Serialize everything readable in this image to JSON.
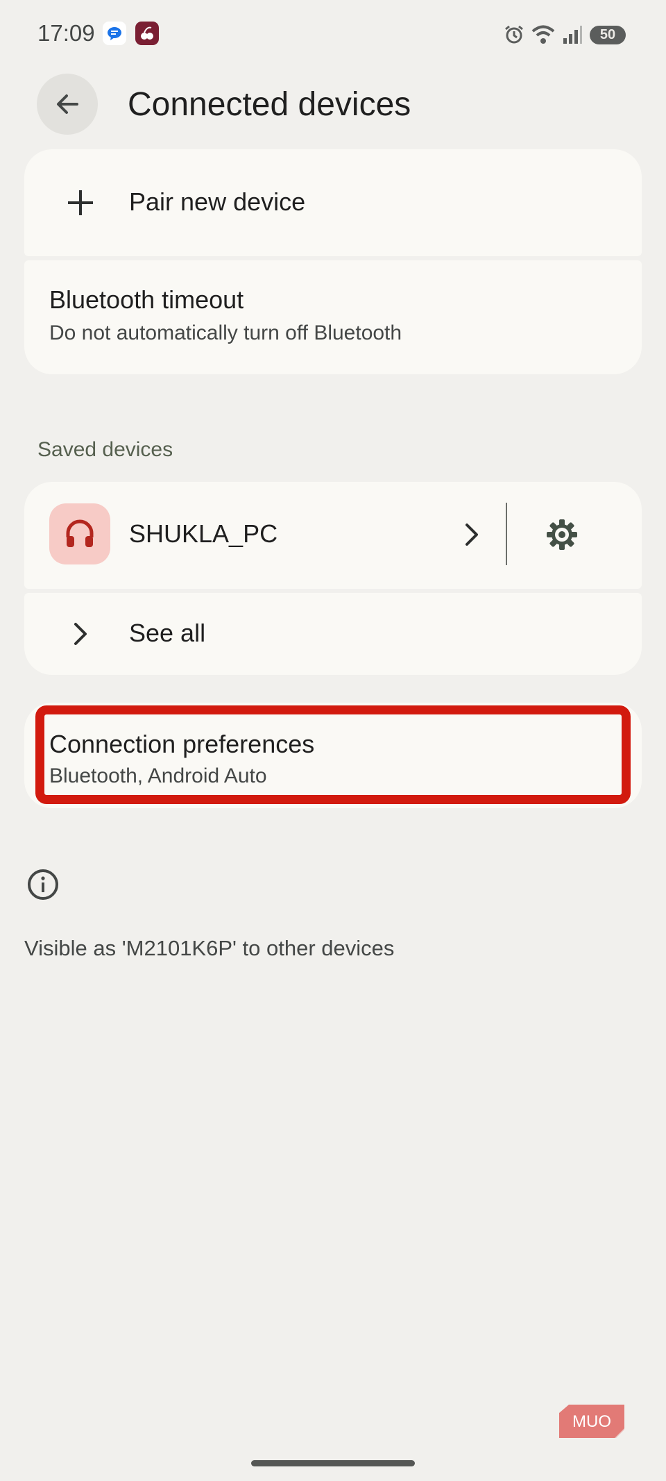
{
  "status_bar": {
    "time": "17:09",
    "battery": "50",
    "icons": [
      "messages-icon",
      "app-icon",
      "alarm-icon",
      "wifi-icon",
      "signal-icon",
      "battery-icon"
    ]
  },
  "header": {
    "title": "Connected devices",
    "back_icon": "arrow-back-icon"
  },
  "pairing_card": {
    "pair_new": {
      "label": "Pair new device",
      "icon": "plus-icon"
    },
    "bluetooth_timeout": {
      "title": "Bluetooth timeout",
      "subtitle": "Do not automatically turn off Bluetooth"
    }
  },
  "saved_devices": {
    "header": "Saved devices",
    "device": {
      "name": "SHUKLA_PC",
      "icon": "headphones-icon"
    },
    "see_all": {
      "label": "See all",
      "icon": "chevron-right-icon"
    }
  },
  "connection_preferences": {
    "title": "Connection preferences",
    "subtitle": "Bluetooth, Android Auto",
    "highlight_color": "#d21a0e"
  },
  "footer": {
    "info_icon": "info-icon",
    "visible_text": "Visible as 'M2101K6P' to other devices"
  },
  "watermark": {
    "text": "MUO"
  },
  "colors": {
    "background": "#f1f0ed",
    "card": "#faf9f5",
    "device_icon_bg": "#f7cbc6",
    "device_icon_fg": "#b3261e",
    "section_header": "#56604f"
  }
}
